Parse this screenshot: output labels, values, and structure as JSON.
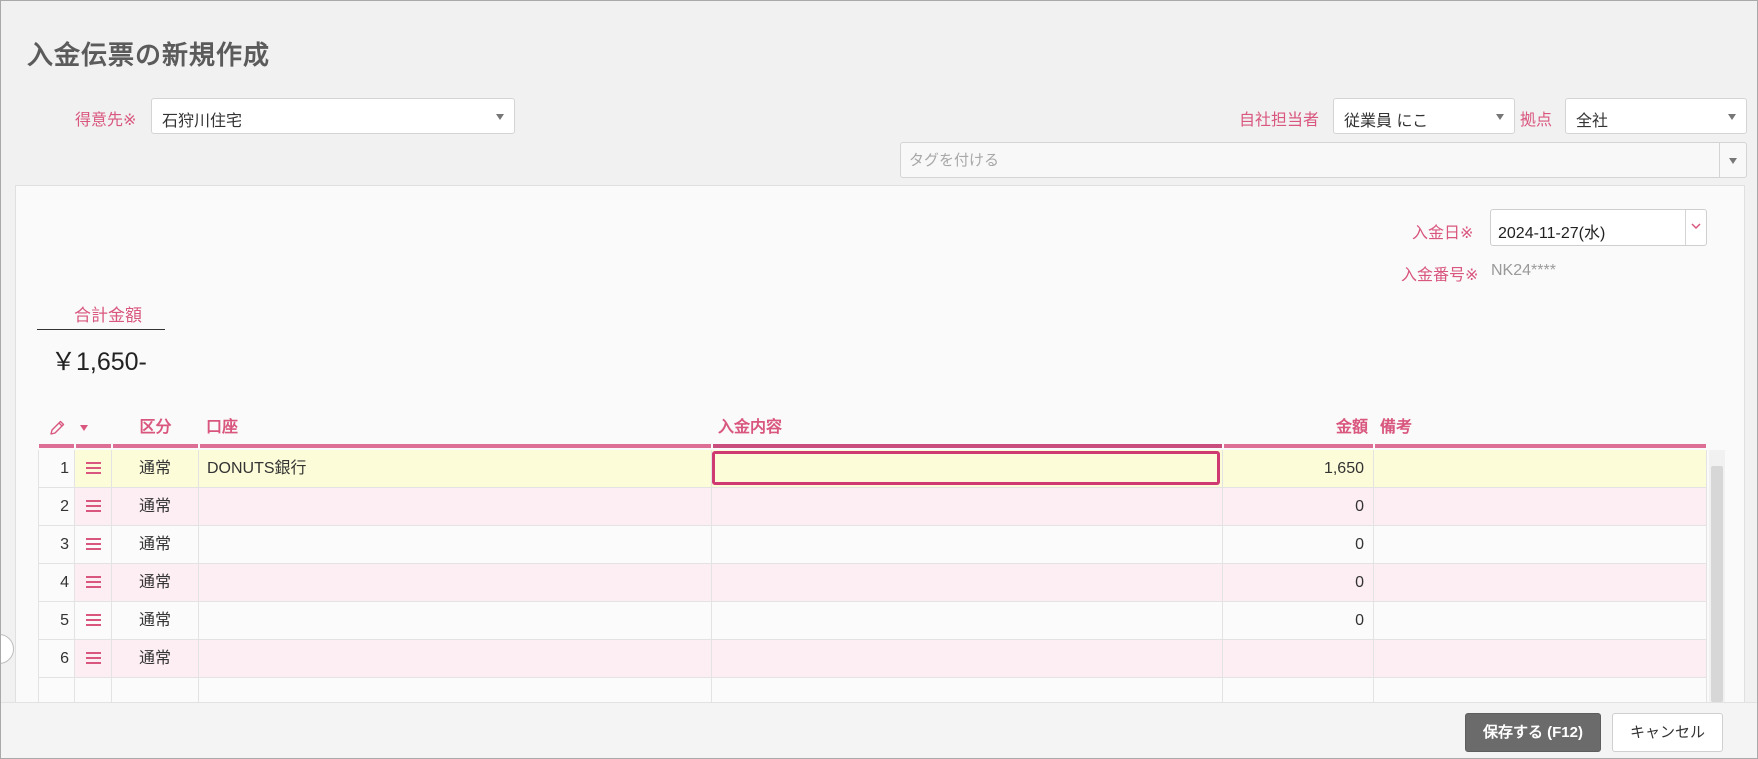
{
  "page": {
    "title": "入金伝票の新規作成"
  },
  "form": {
    "customer": {
      "label": "得意先※",
      "value": "石狩川住宅"
    },
    "staff": {
      "label": "自社担当者",
      "value": "従業員 にこ"
    },
    "base": {
      "label": "拠点",
      "value": "全社"
    },
    "tags": {
      "placeholder": "タグを付ける"
    },
    "date": {
      "label": "入金日※",
      "value": "2024-11-27(水)"
    },
    "number": {
      "label": "入金番号※",
      "value": "NK24****"
    }
  },
  "total": {
    "label": "合計金額",
    "value": "￥1,650-"
  },
  "table": {
    "headers": {
      "kubun": "区分",
      "account": "口座",
      "content": "入金内容",
      "amount": "金額",
      "note": "備考"
    },
    "rows": [
      {
        "no": "1",
        "kubun": "通常",
        "account": "DONUTS銀行",
        "content": "",
        "amount": "1,650",
        "note": "",
        "selected": true,
        "content_focused": true
      },
      {
        "no": "2",
        "kubun": "通常",
        "account": "",
        "content": "",
        "amount": "0",
        "note": ""
      },
      {
        "no": "3",
        "kubun": "通常",
        "account": "",
        "content": "",
        "amount": "0",
        "note": ""
      },
      {
        "no": "4",
        "kubun": "通常",
        "account": "",
        "content": "",
        "amount": "0",
        "note": ""
      },
      {
        "no": "5",
        "kubun": "通常",
        "account": "",
        "content": "",
        "amount": "0",
        "note": ""
      },
      {
        "no": "6",
        "kubun": "通常",
        "account": "",
        "content": "",
        "amount": "",
        "note": ""
      }
    ]
  },
  "footer": {
    "save_label": "保存する (F12)",
    "cancel_label": "キャンセル"
  },
  "icons": {
    "edit": "pencil-icon",
    "column_menu": "caret-down-icon",
    "row_handle": "menu-lines-icon",
    "date_picker": "chevron-down-icon"
  },
  "colors": {
    "accent": "#d9577f",
    "row_selected": "#fdfcd8",
    "row_stripe": "#fdeef4",
    "active_cell_border": "#cf3a72",
    "save_button": "#6b6b6b"
  }
}
